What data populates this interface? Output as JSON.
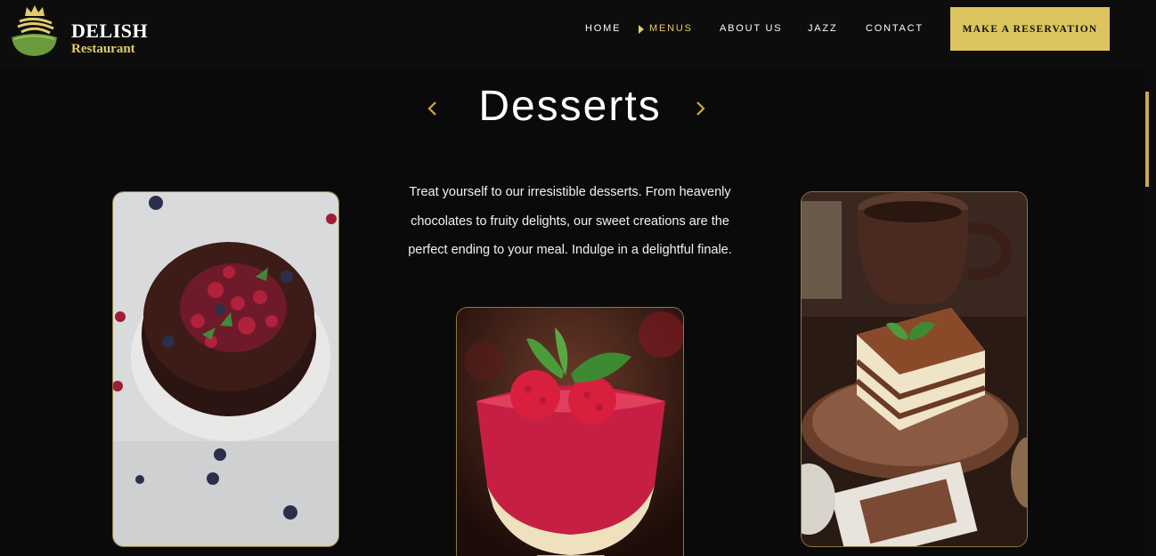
{
  "brand": {
    "name": "DELISH",
    "subtitle": "Restaurant",
    "accent_color": "#e3cc6a"
  },
  "nav": {
    "items": [
      {
        "label": "HOME",
        "active": false
      },
      {
        "label": "MENUS",
        "active": true
      },
      {
        "label": "ABOUT US",
        "active": false
      },
      {
        "label": "JAZZ",
        "active": false
      },
      {
        "label": "CONTACT",
        "active": false
      }
    ],
    "cta_label": "MAKE A RESERVATION",
    "cta_color": "#dcc55f"
  },
  "section": {
    "title": "Desserts",
    "prev_icon": "chevron-left-icon",
    "next_icon": "chevron-right-icon",
    "description": "Treat yourself to our irresistible desserts. From heavenly chocolates to fruity delights, our sweet creations are the perfect ending to your meal. Indulge in a delightful finale."
  },
  "gallery": [
    {
      "image": "chocolate-berry-cake-image"
    },
    {
      "image": "raspberry-panna-cotta-image"
    },
    {
      "image": "tiramisu-coffee-image"
    }
  ]
}
